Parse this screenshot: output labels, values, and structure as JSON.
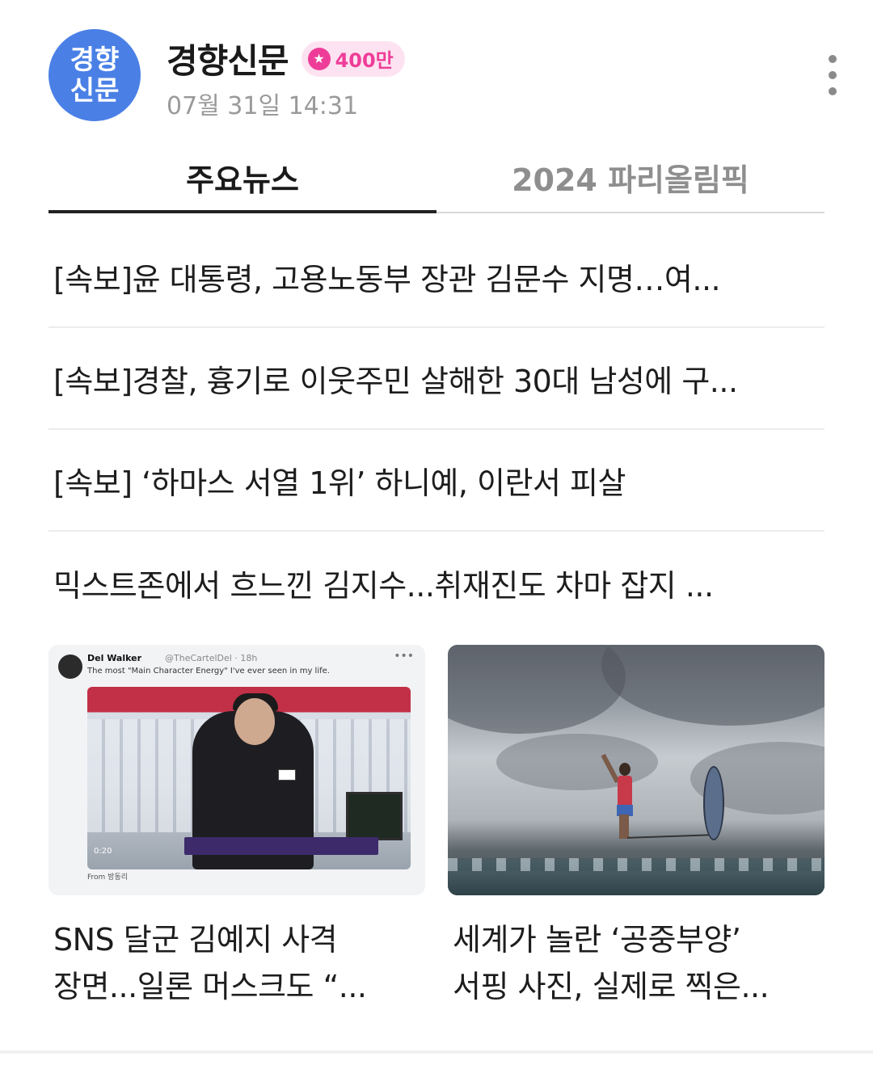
{
  "header": {
    "logo_line1": "경향",
    "logo_line2": "신문",
    "publisher_name": "경향신문",
    "subscriber_badge": "400만",
    "datetime": "07월 31일 14:31",
    "menu_icon": "more-vertical-icon"
  },
  "tabs": [
    {
      "label": "주요뉴스",
      "active": true
    },
    {
      "label": "2024 파리올림픽",
      "active": false
    }
  ],
  "headlines": [
    "[속보]윤 대통령, 고용노동부 장관 김문수 지명…여...",
    "[속보]경찰, 흉기로 이웃주민 살해한 30대 남성에 구...",
    "[속보] ‘하마스 서열 1위’ 하니예, 이란서 피살",
    "믹스트존에서 흐느낀 김지수...취재진도 차마 잡지 ..."
  ],
  "cards": [
    {
      "title_line1": "SNS 달군 김예지 사격",
      "title_line2": "장면...일론 머스크도 “...",
      "tweet": {
        "name": "Del Walker",
        "handle": "@TheCartelDel · 18h",
        "text": "The most \"Main Character Energy\" I've ever seen in my life.",
        "timer": "0:20",
        "from": "From 방동리"
      }
    },
    {
      "title_line1": "세계가 놀란 ‘공중부양’",
      "title_line2": "서핑 사진, 실제로 찍은..."
    }
  ],
  "colors": {
    "logo_bg": "#4a80e6",
    "badge_pink": "#ee3d98",
    "badge_bg": "#fde3f1",
    "tab_inactive": "#8e8e8e"
  }
}
